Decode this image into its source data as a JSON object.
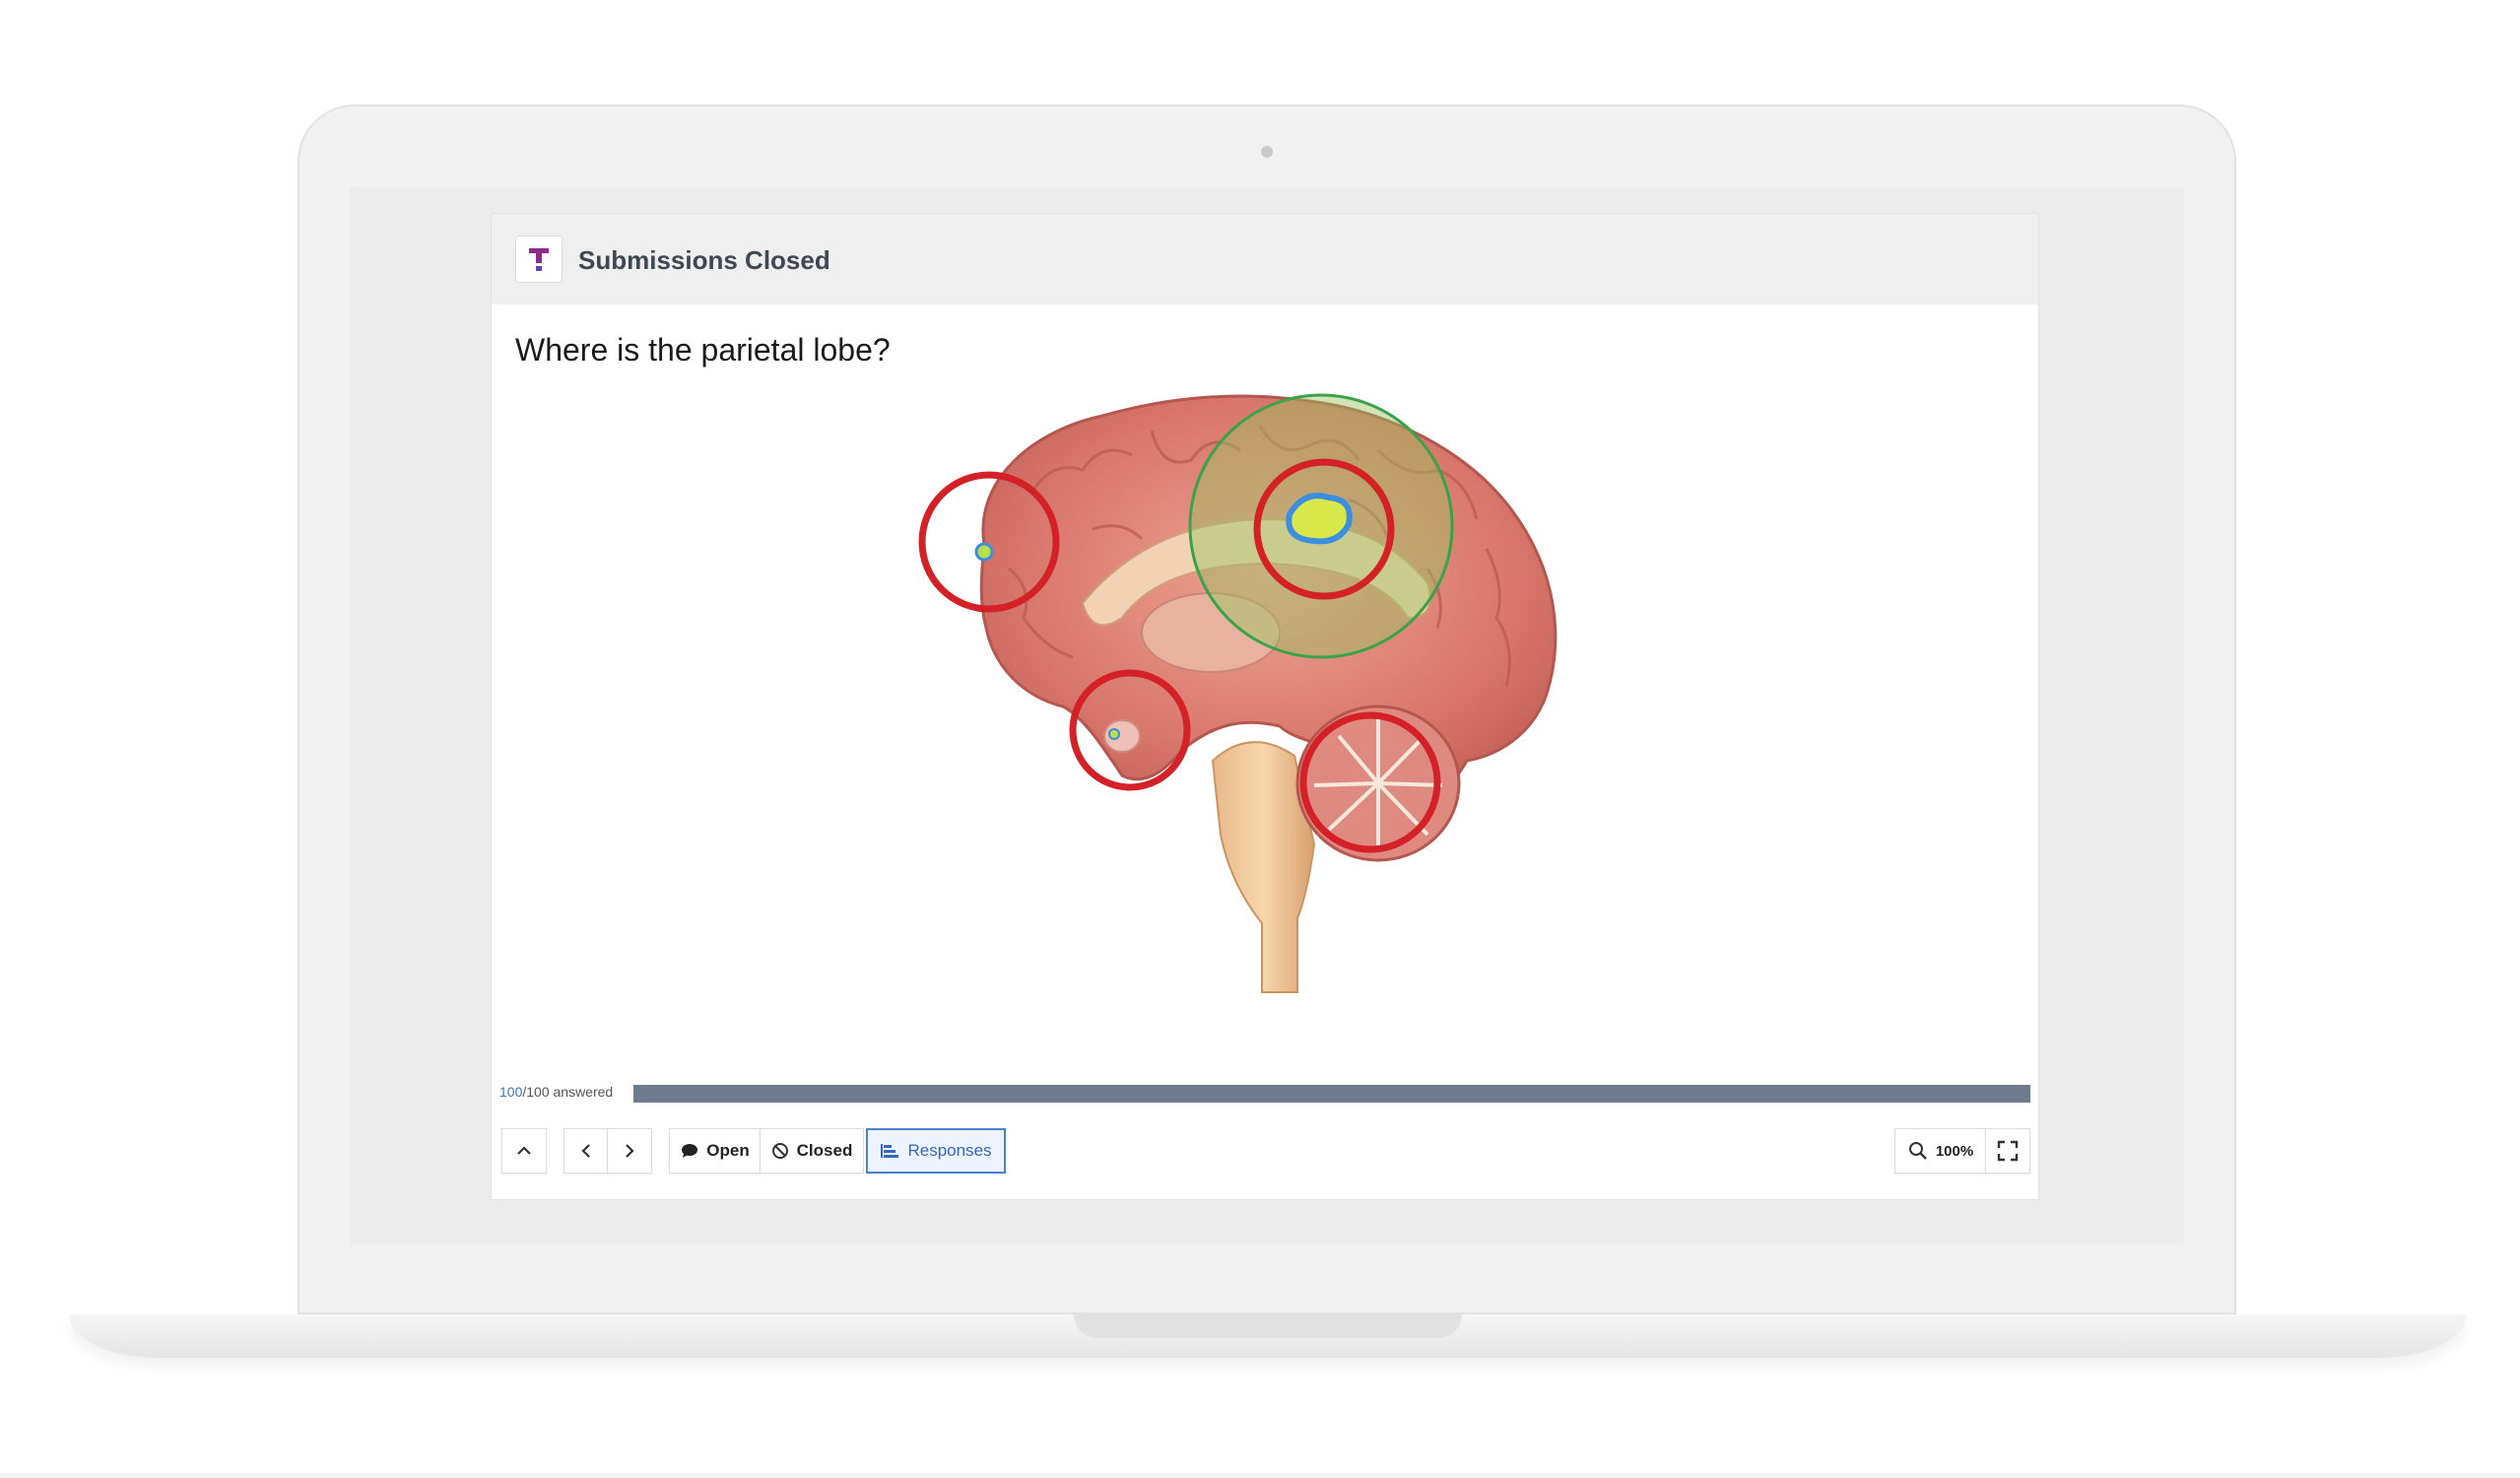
{
  "header": {
    "title": "Submissions Closed",
    "logo_icon": "tophat-logo-icon"
  },
  "question": {
    "text": "Where is the parietal lobe?"
  },
  "progress": {
    "answered": "100",
    "total_text": "/100 answered",
    "fraction": 1.0
  },
  "toolbar": {
    "collapse_icon": "chevron-up-icon",
    "prev_icon": "chevron-left-icon",
    "next_icon": "chevron-right-icon",
    "open_label": "Open",
    "closed_label": "Closed",
    "responses_label": "Responses",
    "zoom_label": "100%",
    "fullscreen_icon": "fullscreen-icon"
  },
  "colors": {
    "accent": "#4c82d6",
    "wrong_marker": "#d42027",
    "correct_region": "#3aa34a",
    "progress_fill": "#6e7b8d"
  }
}
